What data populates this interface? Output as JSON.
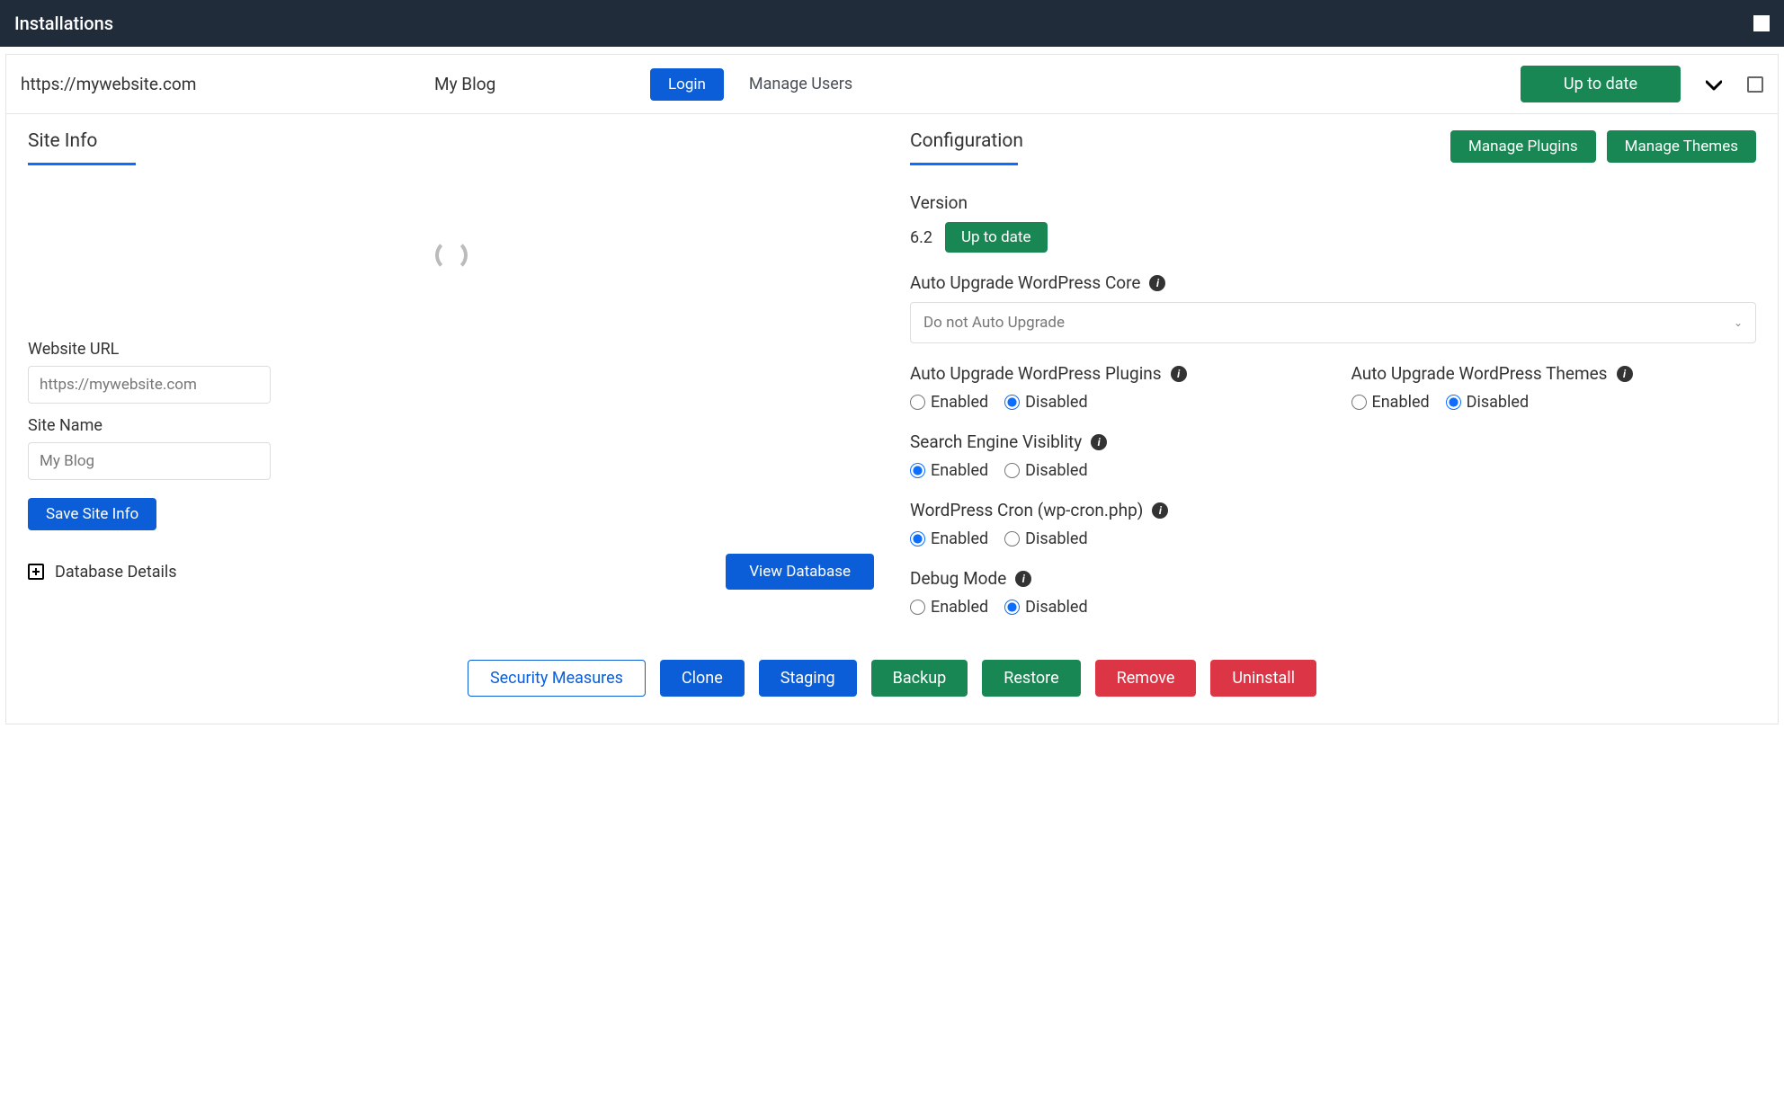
{
  "header": {
    "title": "Installations"
  },
  "site": {
    "url": "https://mywebsite.com",
    "name": "My Blog",
    "login_btn": "Login",
    "manage_users": "Manage Users",
    "update_status": "Up to date"
  },
  "siteinfo": {
    "title": "Site Info",
    "website_url_label": "Website URL",
    "website_url_value": "https://mywebsite.com",
    "site_name_label": "Site Name",
    "site_name_value": "My Blog",
    "save_btn": "Save Site Info",
    "db_details": "Database Details",
    "view_db": "View Database"
  },
  "config": {
    "title": "Configuration",
    "manage_plugins": "Manage Plugins",
    "manage_themes": "Manage Themes",
    "version_label": "Version",
    "version_value": "6.2",
    "version_badge": "Up to date",
    "auto_core_label": "Auto Upgrade WordPress Core",
    "auto_core_value": "Do not Auto Upgrade",
    "auto_plugins_label": "Auto Upgrade WordPress Plugins",
    "auto_themes_label": "Auto Upgrade WordPress Themes",
    "search_engine_label": "Search Engine Visiblity",
    "cron_label": "WordPress Cron (wp-cron.php)",
    "debug_label": "Debug Mode",
    "enabled": "Enabled",
    "disabled": "Disabled"
  },
  "footer": {
    "security": "Security Measures",
    "clone": "Clone",
    "staging": "Staging",
    "backup": "Backup",
    "restore": "Restore",
    "remove": "Remove",
    "uninstall": "Uninstall"
  }
}
